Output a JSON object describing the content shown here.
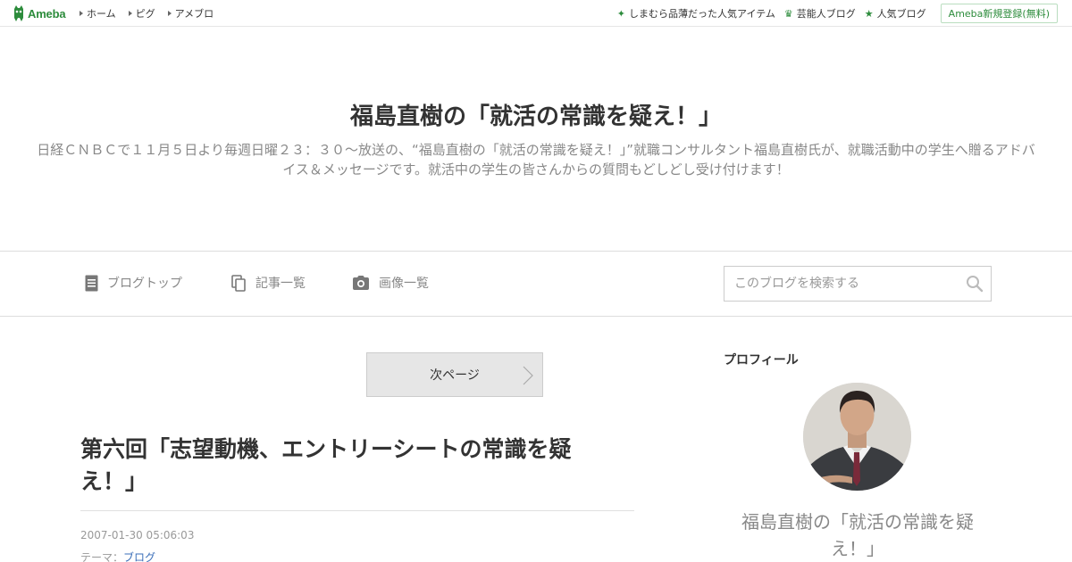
{
  "topbar": {
    "logo_text": "Ameba",
    "nav": [
      "ホーム",
      "ピグ",
      "アメブロ"
    ],
    "right_links": [
      {
        "label": "しまむら品薄だった人気アイテム",
        "icon": "sparkle-icon"
      },
      {
        "label": "芸能人ブログ",
        "icon": "crown-icon"
      },
      {
        "label": "人気ブログ",
        "icon": "star-icon"
      }
    ],
    "register_label": "Ameba新規登録(無料)"
  },
  "header": {
    "title": "福島直樹の「就活の常識を疑え！」",
    "description": "日経ＣＮＢＣで１１月５日より毎週日曜２３：３０～放送の、“福島直樹の「就活の常識を疑え！」”就職コンサルタント福島直樹氏が、就職活動中の学生へ贈るアドバイス＆メッセージです。就活中の学生の皆さんからの質問もどしどし受け付けます！"
  },
  "navbar": {
    "blog_top": "ブログトップ",
    "entry_list": "記事一覧",
    "image_list": "画像一覧",
    "search_placeholder": "このブログを検索する"
  },
  "article": {
    "next_page": "次ページ",
    "title": "第六回「志望動機、エントリーシートの常識を疑え！」",
    "date": "2007-01-30 05:06:03",
    "theme_label": "テーマ：",
    "theme_value": "ブログ"
  },
  "sidebar": {
    "profile_heading": "プロフィール",
    "profile_name": "福島直樹の「就活の常識を疑え！」"
  },
  "colors": {
    "accent": "#2d8c3c",
    "link": "#3a6eb8",
    "muted": "#888888"
  }
}
